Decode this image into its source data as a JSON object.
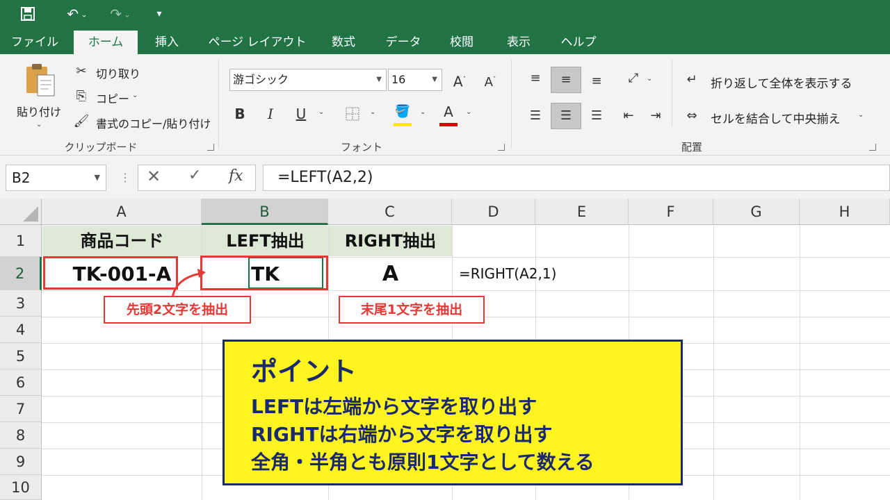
{
  "quick_access": {
    "save_icon": "save-icon",
    "undo_icon": "undo-icon",
    "redo_icon": "redo-icon",
    "customize_icon": "customize-icon"
  },
  "tabs": [
    "ファイル",
    "ホーム",
    "挿入",
    "ページ レイアウト",
    "数式",
    "データ",
    "校閲",
    "表示",
    "ヘルプ"
  ],
  "ribbon": {
    "clipboard": {
      "paste": "貼り付け",
      "cut": "切り取り",
      "copy": "コピー",
      "format_painter": "書式のコピー/貼り付け",
      "label": "クリップボード"
    },
    "font": {
      "font_name": "游ゴシック",
      "font_size": "16",
      "bold": "B",
      "italic": "I",
      "underline": "U",
      "grow": "A",
      "shrink": "A",
      "font_color_letter": "A",
      "label": "フォント",
      "fill_color": "#ffeb00",
      "font_color": "#e00000"
    },
    "alignment": {
      "wrap_text": "折り返して全体を表示する",
      "merge_center": "セルを結合して中央揃え",
      "label": "配置"
    }
  },
  "formula_bar": {
    "name_box": "B2",
    "fx": "fx",
    "formula": "=LEFT(A2,2)"
  },
  "grid": {
    "columns": [
      "A",
      "B",
      "C",
      "D",
      "E",
      "F",
      "G",
      "H"
    ],
    "rows": [
      "1",
      "2",
      "3",
      "4",
      "5",
      "6",
      "7",
      "8",
      "9",
      "10"
    ],
    "cells": {
      "A1": "商品コード",
      "B1": "LEFT抽出",
      "C1": "RIGHT抽出",
      "A2": "TK-001-A",
      "B2": "TK",
      "C2": "A",
      "D2": "=RIGHT(A2,1)"
    }
  },
  "callouts": {
    "left": "先頭2文字を抽出",
    "right": "末尾1文字を抽出"
  },
  "point_box": {
    "title": "ポイント",
    "lines": [
      "LEFTは左端から文字を取り出す",
      "RIGHTは右端から文字を取り出す",
      "全角・半角とも原則1文字として数える"
    ]
  }
}
